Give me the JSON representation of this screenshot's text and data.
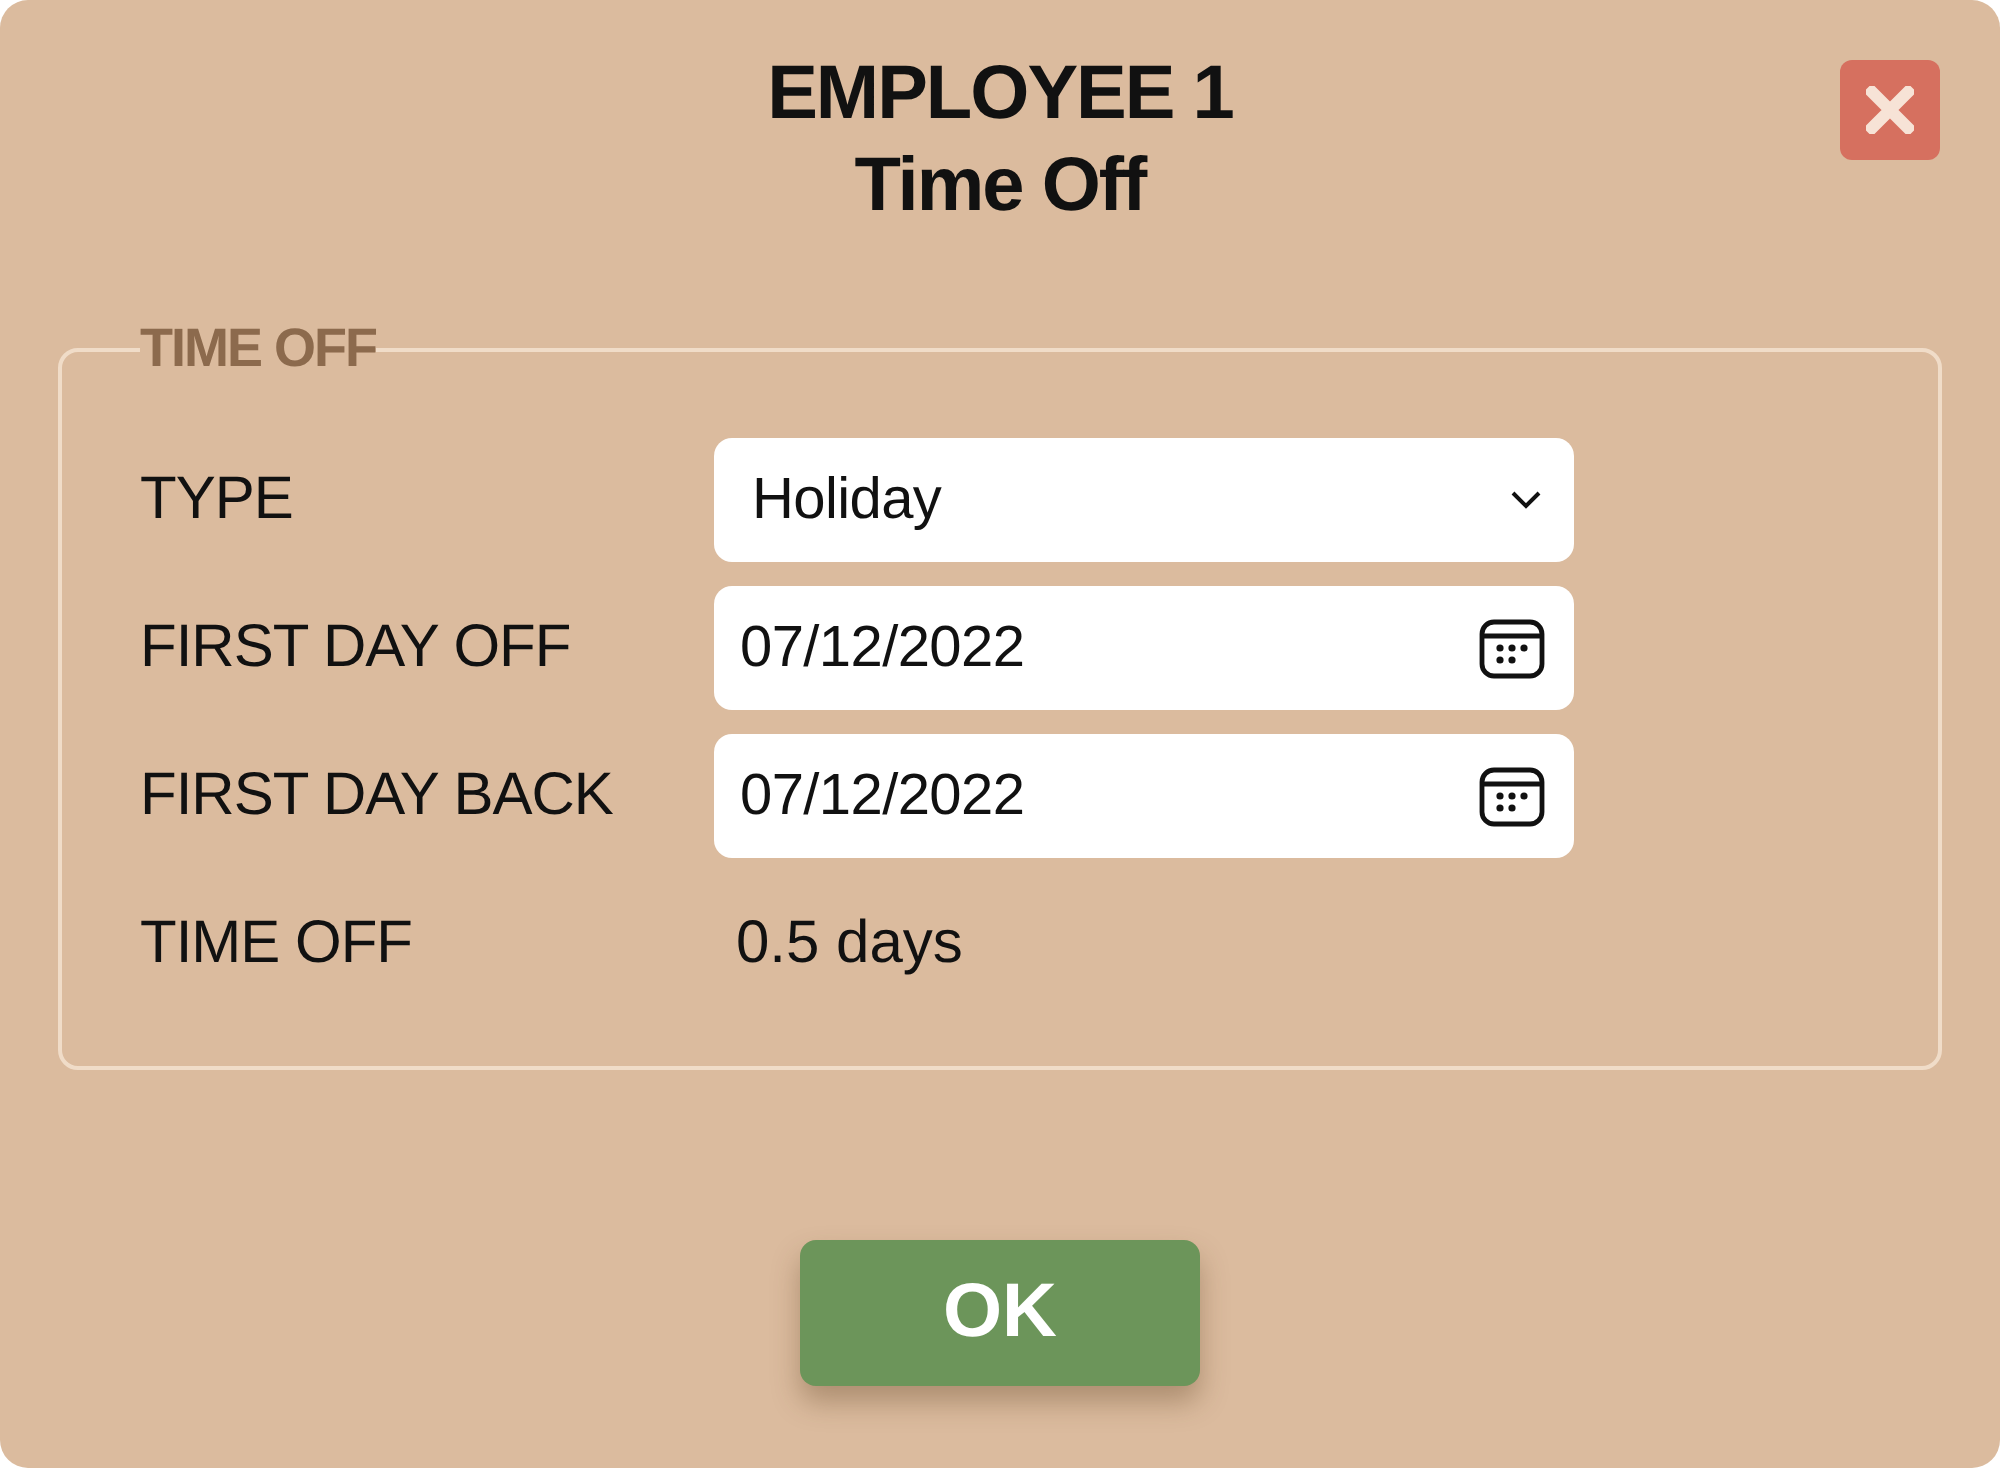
{
  "dialog": {
    "title": "EMPLOYEE 1",
    "subtitle": "Time Off"
  },
  "group": {
    "legend": "TIME OFF",
    "rows": [
      {
        "kind": "select",
        "label": "TYPE",
        "value": "Holiday"
      },
      {
        "kind": "date",
        "label": "FIRST DAY OFF",
        "value": "07/12/2022"
      },
      {
        "kind": "date",
        "label": "FIRST DAY BACK",
        "value": "07/12/2022"
      },
      {
        "kind": "text",
        "label": "TIME OFF",
        "value": "0.5 days"
      }
    ]
  },
  "buttons": [
    {
      "label": "OK"
    }
  ]
}
